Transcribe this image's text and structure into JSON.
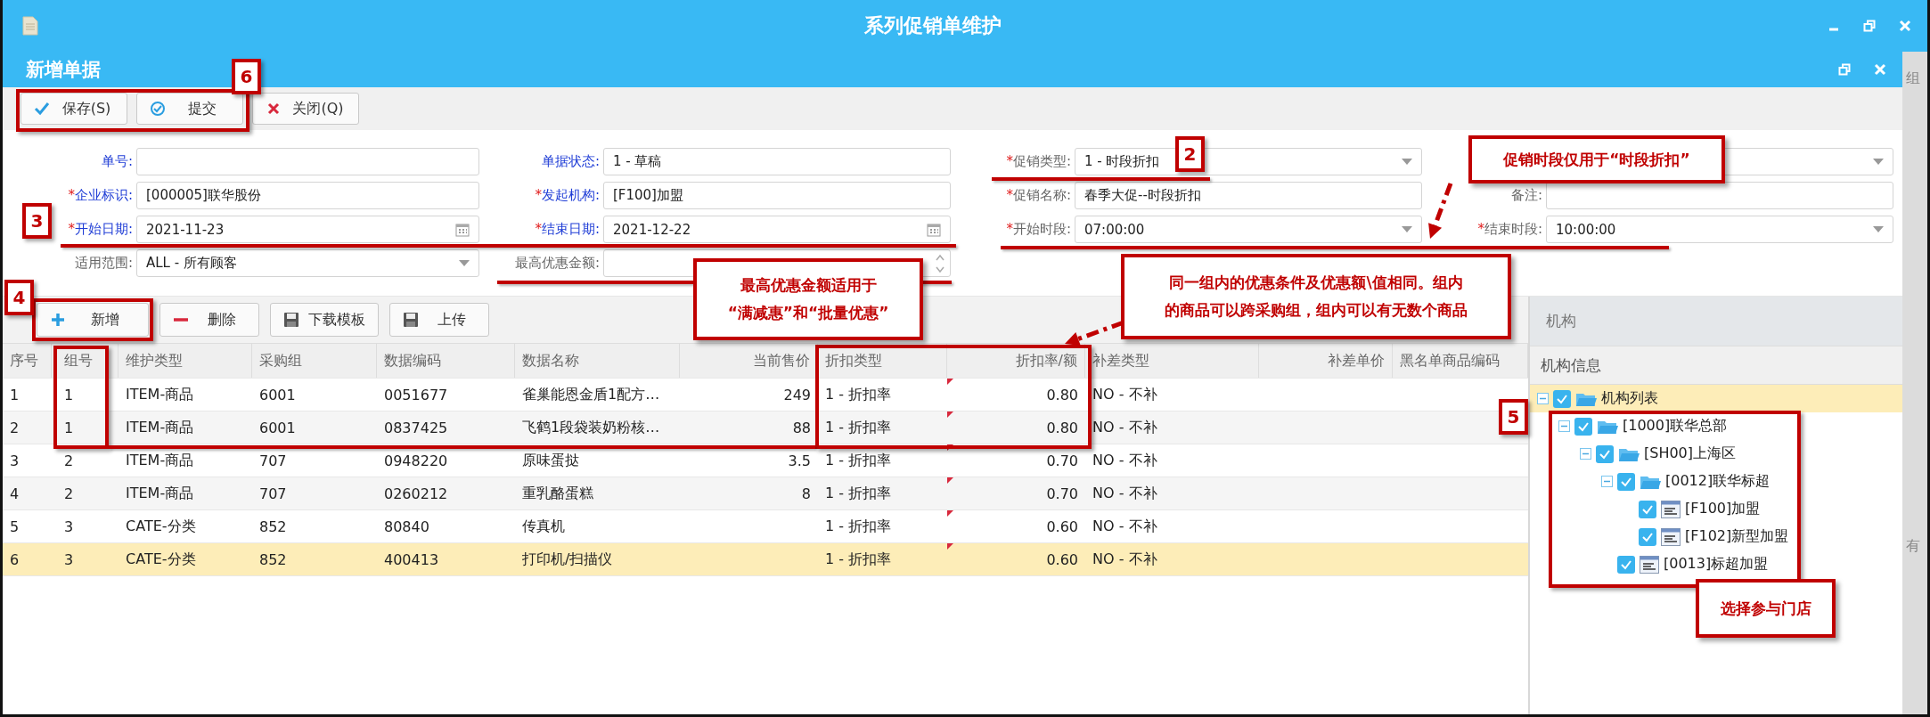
{
  "window": {
    "title": "系列促销单维护"
  },
  "document": {
    "title": "新增单据"
  },
  "toolbar": [
    {
      "kind": "check",
      "label": "保存(S)"
    },
    {
      "kind": "circle-check",
      "label": "提交"
    },
    {
      "kind": "cross",
      "label": "关闭(Q)"
    }
  ],
  "form": {
    "rows": [
      [
        {
          "label": "单号:",
          "emphasis": true,
          "kind": "text"
        },
        {
          "label": "单据状态:",
          "emphasis": true,
          "kind": "text",
          "value": "1 - 草稿"
        },
        {
          "required_mark": "*",
          "label": "促销类型:",
          "emphasis": false,
          "kind": "select",
          "value": "1 - 时段折扣"
        },
        {
          "kind": "select"
        }
      ],
      [
        {
          "required_mark": "*",
          "label": "企业标识:",
          "emphasis": true,
          "kind": "text",
          "value": "[000005]联华股份"
        },
        {
          "required_mark": "*",
          "label": "发起机构:",
          "emphasis": true,
          "kind": "text",
          "value": "[F100]加盟"
        },
        {
          "required_mark": "*",
          "label": "促销名称:",
          "emphasis": false,
          "kind": "text",
          "value": "春季大促--时段折扣"
        },
        {
          "label": "备注:",
          "emphasis": false,
          "kind": "text"
        }
      ],
      [
        {
          "required_mark": "*",
          "label": "开始日期:",
          "emphasis": true,
          "kind": "date",
          "value": "2021-11-23"
        },
        {
          "required_mark": "*",
          "label": "结束日期:",
          "emphasis": true,
          "kind": "date",
          "value": "2021-12-22"
        },
        {
          "required_mark": "*",
          "label": "开始时段:",
          "emphasis": false,
          "kind": "select",
          "value": "07:00:00"
        },
        {
          "required_mark": "*",
          "label": "结束时段:",
          "emphasis": false,
          "kind": "select",
          "value": "10:00:00"
        }
      ],
      [
        {
          "label": "适用范围:",
          "emphasis": false,
          "kind": "select",
          "value": "ALL - 所有顾客"
        },
        {
          "label": "最高优惠金额:",
          "emphasis": false,
          "kind": "number"
        }
      ]
    ]
  },
  "grid_toolbar": [
    {
      "kind": "plus",
      "label": "新增"
    },
    {
      "kind": "minus",
      "label": "删除"
    },
    {
      "kind": "disk",
      "label": "下载模板"
    },
    {
      "kind": "disk",
      "label": "上传"
    }
  ],
  "table": {
    "columns": [
      {
        "label": "序号",
        "numeric": false,
        "modified": false
      },
      {
        "label": "组号",
        "numeric": false,
        "modified": false
      },
      {
        "label": "维护类型",
        "numeric": false,
        "modified": false
      },
      {
        "label": "采购组",
        "numeric": false,
        "modified": false
      },
      {
        "label": "数据编码",
        "numeric": false,
        "modified": false
      },
      {
        "label": "数据名称",
        "numeric": false,
        "modified": false
      },
      {
        "label": "当前售价",
        "numeric": true,
        "modified": false
      },
      {
        "label": "折扣类型",
        "numeric": false,
        "modified": false
      },
      {
        "label": "折扣率/额",
        "numeric": true,
        "modified": true
      },
      {
        "label": "补差类型",
        "numeric": false,
        "modified": false
      },
      {
        "label": "补差单价",
        "numeric": true,
        "modified": false
      },
      {
        "label": "黑名单商品编码",
        "numeric": false,
        "modified": false
      }
    ],
    "rows": [
      {
        "selected": false,
        "cells": [
          "1",
          "1",
          "ITEM-商品",
          "6001",
          "0051677",
          "雀巢能恩金盾1配方…",
          "249",
          "1 - 折扣率",
          "0.80",
          "NO - 不补",
          null,
          null
        ]
      },
      {
        "selected": false,
        "cells": [
          "2",
          "1",
          "ITEM-商品",
          "6001",
          "0837425",
          "飞鹤1段袋装奶粉核…",
          "88",
          "1 - 折扣率",
          "0.80",
          "NO - 不补",
          null,
          null
        ]
      },
      {
        "selected": false,
        "cells": [
          "3",
          "2",
          "ITEM-商品",
          "707",
          "0948220",
          "原味蛋挞",
          "3.5",
          "1 - 折扣率",
          "0.70",
          "NO - 不补",
          null,
          null
        ]
      },
      {
        "selected": false,
        "cells": [
          "4",
          "2",
          "ITEM-商品",
          "707",
          "0260212",
          "重乳酪蛋糕",
          "8",
          "1 - 折扣率",
          "0.70",
          "NO - 不补",
          null,
          null
        ]
      },
      {
        "selected": false,
        "cells": [
          "5",
          "3",
          "CATE-分类",
          "852",
          "80840",
          "传真机",
          null,
          "1 - 折扣率",
          "0.60",
          "NO - 不补",
          null,
          null
        ]
      },
      {
        "selected": true,
        "cells": [
          "6",
          "3",
          "CATE-分类",
          "852",
          "400413",
          "打印机/扫描仪",
          null,
          "1 - 折扣率",
          "0.60",
          "NO - 不补",
          null,
          null
        ]
      }
    ]
  },
  "panel": {
    "title": "机构",
    "subtitle": "机构信息",
    "tree": [
      {
        "label": "机构列表",
        "kind": "folder",
        "checked": true,
        "expanded": true,
        "selected": true,
        "children": [
          {
            "label": "[1000]联华总部",
            "kind": "folder",
            "checked": true,
            "expanded": true,
            "selected": false,
            "children": [
              {
                "label": "[SH00]上海区",
                "kind": "folder",
                "checked": true,
                "expanded": true,
                "selected": false,
                "children": [
                  {
                    "label": "[0012]联华标超",
                    "kind": "folder",
                    "checked": true,
                    "expanded": true,
                    "selected": false,
                    "children": [
                      {
                        "label": "[F100]加盟",
                        "kind": "store",
                        "checked": true,
                        "selected": false
                      },
                      {
                        "label": "[F102]新型加盟",
                        "kind": "store",
                        "checked": true,
                        "selected": false
                      }
                    ]
                  },
                  {
                    "label": "[0013]标超加盟",
                    "kind": "store",
                    "checked": true,
                    "selected": false
                  }
                ]
              }
            ]
          }
        ]
      }
    ]
  },
  "background_window": {
    "texts": [
      "组",
      "有"
    ]
  },
  "annotations": {
    "markers": [
      "6",
      "2",
      "3",
      "4",
      "5"
    ],
    "callouts": [
      {
        "lines": [
          "最高优惠金额适用于",
          "“满减惠”和“批量优惠”"
        ]
      },
      {
        "lines": [
          "促销时段仅用于“时段折扣”"
        ]
      },
      {
        "lines": [
          "同一组内的优惠条件及优惠额\\值相同。组内",
          "的商品可以跨采购组，组内可以有无数个商品"
        ]
      },
      {
        "lines": [
          "选择参与门店"
        ]
      }
    ]
  }
}
